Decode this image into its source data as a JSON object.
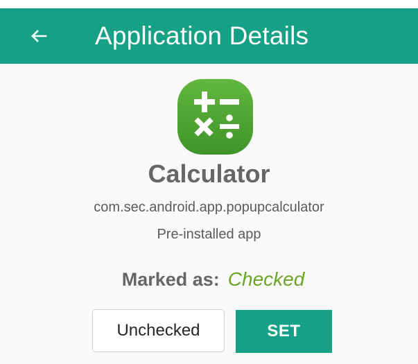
{
  "header": {
    "title": "Application Details",
    "back_icon": "back-arrow-icon"
  },
  "app": {
    "icon": "calculator-icon",
    "name": "Calculator",
    "package": "com.sec.android.app.popupcalculator",
    "install_type": "Pre-installed app"
  },
  "status": {
    "label": "Marked as:",
    "value": "Checked",
    "select_value": "Unchecked",
    "set_label": "SET"
  },
  "colors": {
    "primary": "#16a086",
    "checked": "#6aa425",
    "icon_green": "#4a9d2b"
  }
}
